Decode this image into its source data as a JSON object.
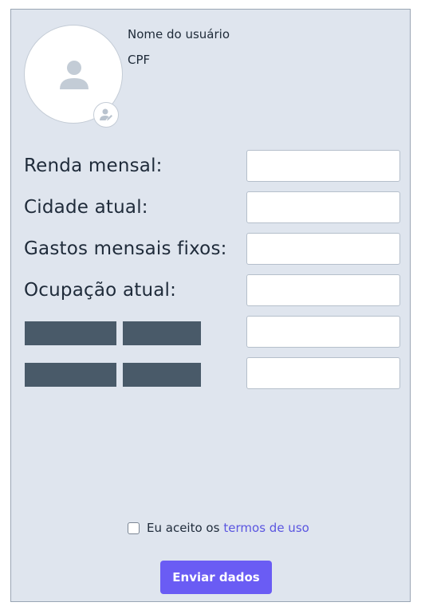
{
  "profile": {
    "name_label": "Nome do usuário",
    "cpf_label": "CPF",
    "avatar_icon": "user-icon",
    "change_photo_icon": "user-edit-icon"
  },
  "form": {
    "fields": [
      {
        "label": "Renda mensal:",
        "value": ""
      },
      {
        "label": "Cidade atual:",
        "value": ""
      },
      {
        "label": "Gastos mensais fixos:",
        "value": ""
      },
      {
        "label": "Ocupação atual:",
        "value": ""
      },
      {
        "label": "",
        "value": ""
      },
      {
        "label": "",
        "value": ""
      }
    ]
  },
  "terms": {
    "prefix": "Eu aceito os",
    "link": "termos de uso",
    "checked": false
  },
  "submit_label": "Enviar dados",
  "colors": {
    "card_bg": "#dfe5ee",
    "accent": "#6a5cf4",
    "link": "#5a55e0",
    "redaction": "#495a69"
  }
}
